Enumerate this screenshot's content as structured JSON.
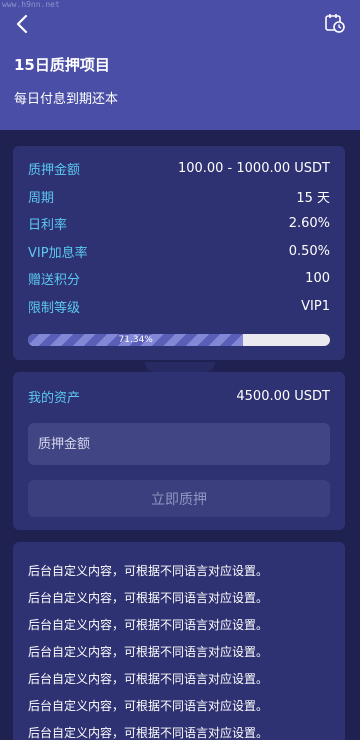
{
  "watermark": "www.h9nn.net",
  "header": {
    "title": "15日质押项目",
    "subtitle": "每日付息到期还本"
  },
  "icons": {
    "back": "back-arrow-icon",
    "history": "calendar-clock-icon"
  },
  "info": {
    "rows": [
      {
        "label": "质押金额",
        "value": "100.00 - 1000.00 USDT"
      },
      {
        "label": "周期",
        "value": "15 天"
      },
      {
        "label": "日利率",
        "value": "2.60%"
      },
      {
        "label": "VIP加息率",
        "value": "0.50%"
      },
      {
        "label": "赠送积分",
        "value": "100"
      },
      {
        "label": "限制等级",
        "value": "VIP1"
      }
    ],
    "progress_label": "71.34%",
    "progress_fraction": 0.7134
  },
  "assets": {
    "label": "我的资产",
    "value": "4500.00 USDT",
    "input_placeholder": "质押金额",
    "input_value": "",
    "button_label": "立即质押"
  },
  "description": {
    "lines": [
      "后台自定义内容，可根据不同语言对应设置。",
      "后台自定义内容，可根据不同语言对应设置。",
      "后台自定义内容，可根据不同语言对应设置。",
      "后台自定义内容，可根据不同语言对应设置。",
      "后台自定义内容，可根据不同语言对应设置。",
      "后台自定义内容，可根据不同语言对应设置。",
      "后台自定义内容，可根据不同语言对应设置。"
    ]
  },
  "colors": {
    "background": "#1f2150",
    "header": "#4a4ea6",
    "card": "#2e3172",
    "label_accent": "#5bc8f0",
    "progress_track": "#e9e9ef"
  }
}
